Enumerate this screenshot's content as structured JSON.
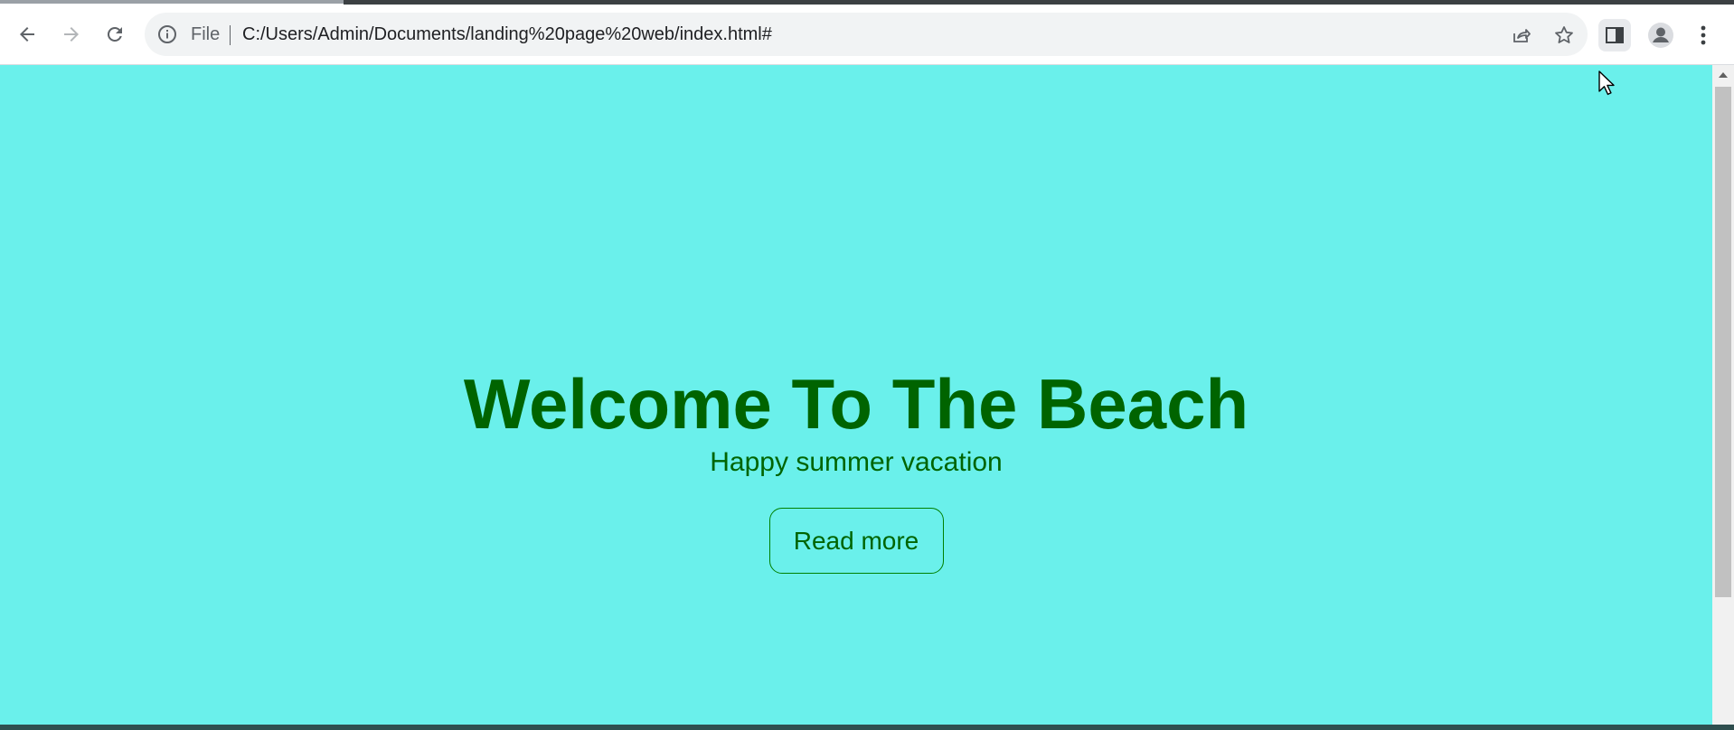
{
  "browser": {
    "nav": {
      "back_icon": "arrow-back-icon",
      "forward_icon": "arrow-forward-icon",
      "reload_icon": "reload-icon"
    },
    "address_bar": {
      "info_icon": "info-icon",
      "scheme_label": "File",
      "url": "C:/Users/Admin/Documents/landing%20page%20web/index.html#",
      "share_icon": "share-icon",
      "bookmark_icon": "star-icon"
    },
    "side_panel_icon": "side-panel-icon",
    "profile_icon": "profile-icon",
    "menu_icon": "kebab-menu-icon"
  },
  "page": {
    "background_color": "#6af0eb",
    "text_color": "#006400",
    "hero": {
      "title": "Welcome To The Beach",
      "subtitle": "Happy summer vacation",
      "button_label": "Read more"
    }
  },
  "scrollbar": {
    "up_icon": "scroll-up-arrow-icon"
  },
  "cursor_icon": "mouse-pointer-icon"
}
